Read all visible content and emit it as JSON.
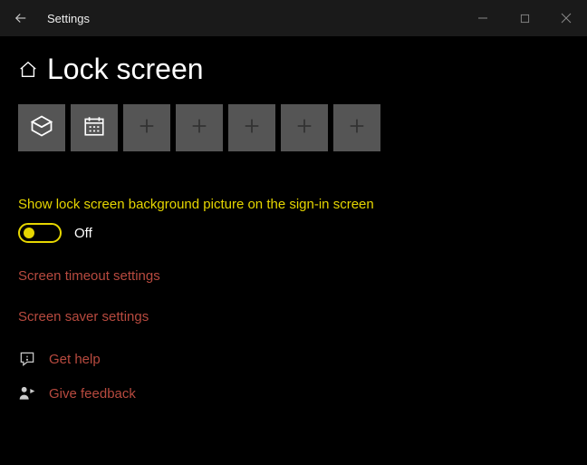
{
  "window": {
    "title": "Settings"
  },
  "page": {
    "title": "Lock screen"
  },
  "apps": [
    {
      "kind": "mail"
    },
    {
      "kind": "calendar"
    },
    {
      "kind": "add"
    },
    {
      "kind": "add"
    },
    {
      "kind": "add"
    },
    {
      "kind": "add"
    },
    {
      "kind": "add"
    }
  ],
  "toggle": {
    "label": "Show lock screen background picture on the sign-in screen",
    "state_label": "Off",
    "value": false
  },
  "links": {
    "timeout": "Screen timeout settings",
    "screensaver": "Screen saver settings",
    "help": "Get help",
    "feedback": "Give feedback"
  }
}
